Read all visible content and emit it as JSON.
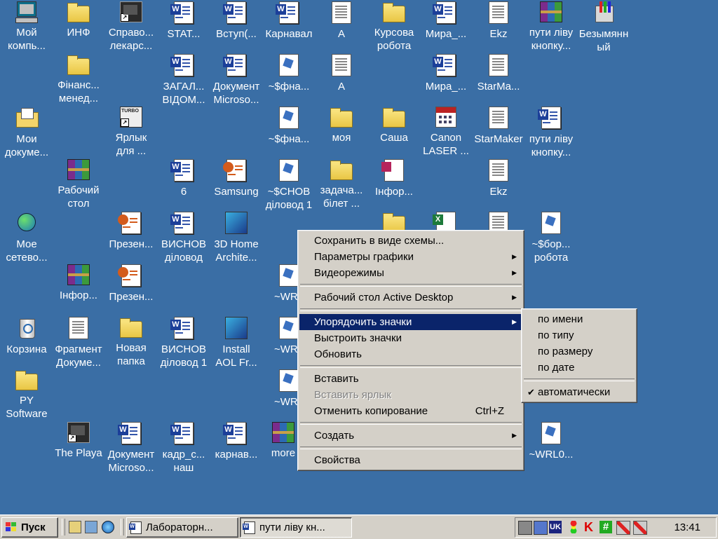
{
  "desktop": {
    "icons": [
      {
        "id": "my-computer",
        "label": "Мой\nкомпь...",
        "type": "computer"
      },
      {
        "id": "inf",
        "label": "ИНФ",
        "type": "folder"
      },
      {
        "id": "spravochnik",
        "label": "Справо...\nлекарс...",
        "type": "exe"
      },
      {
        "id": "stat",
        "label": "STAT...",
        "type": "word"
      },
      {
        "id": "vstup",
        "label": "Вступ(...",
        "type": "word"
      },
      {
        "id": "karnaval",
        "label": "Карнавал",
        "type": "word"
      },
      {
        "id": "a1",
        "label": "А",
        "type": "text"
      },
      {
        "id": "kursova",
        "label": "Курсова\nробота",
        "type": "folder"
      },
      {
        "id": "mira1",
        "label": "Мира_...",
        "type": "word"
      },
      {
        "id": "ekz1",
        "label": "Ekz",
        "type": "text"
      },
      {
        "id": "puti1",
        "label": "пути ліву\nкнопку...",
        "type": "rar"
      },
      {
        "id": "bezymyannyi",
        "label": "Безымянн\nый",
        "type": "paint"
      },
      {
        "id": "finans",
        "label": "Фінанс...\nменед...",
        "type": "folder"
      },
      {
        "id": "zagal",
        "label": "ЗАГАЛ...\nВІДОМ...",
        "type": "word"
      },
      {
        "id": "document1",
        "label": "Документ\nMicroso...",
        "type": "word"
      },
      {
        "id": "fna1",
        "label": "~$фна...",
        "type": "mwd"
      },
      {
        "id": "a2",
        "label": "А",
        "type": "text"
      },
      {
        "id": "mira2",
        "label": "Мира_...",
        "type": "word"
      },
      {
        "id": "starma",
        "label": "StarMa...",
        "type": "text"
      },
      {
        "id": "my-docs",
        "label": "Мои\nдокуме...",
        "type": "mydocs"
      },
      {
        "id": "turbo",
        "label": "Ярлык\nдля ...",
        "type": "turbo"
      },
      {
        "id": "fna2",
        "label": "~$фна...",
        "type": "mwd"
      },
      {
        "id": "moya",
        "label": "моя",
        "type": "folder"
      },
      {
        "id": "sasha",
        "label": "Саша",
        "type": "folder"
      },
      {
        "id": "canon",
        "label": "Canon\nLASER ...",
        "type": "cal"
      },
      {
        "id": "starmaker",
        "label": "StarMaker",
        "type": "text"
      },
      {
        "id": "puti2",
        "label": "пути ліву\nкнопку...",
        "type": "word"
      },
      {
        "id": "rabochiy",
        "label": "Рабочий\nстол",
        "type": "rar"
      },
      {
        "id": "six",
        "label": "6",
        "type": "word"
      },
      {
        "id": "samsung",
        "label": "Samsung",
        "type": "ppt"
      },
      {
        "id": "snov",
        "label": "~$СНОВ\nділовод 1",
        "type": "mwd"
      },
      {
        "id": "zadacha",
        "label": "задача...\nбілет ...",
        "type": "folder"
      },
      {
        "id": "infor1",
        "label": "Інфор...",
        "type": "pdfish"
      },
      {
        "id": "ekz2",
        "label": "Ekz",
        "type": "text"
      },
      {
        "id": "network",
        "label": "Мое\nсетево...",
        "type": "net"
      },
      {
        "id": "prezen1",
        "label": "Презен...",
        "type": "ppt"
      },
      {
        "id": "vysnov1",
        "label": "ВИСНОВ\nділовод",
        "type": "word"
      },
      {
        "id": "home3d",
        "label": "3D Home\nArchite...",
        "type": "img"
      },
      {
        "id": "fbor",
        "label": "~$бор...\nробота",
        "type": "mwd"
      },
      {
        "id": "infor2",
        "label": "Інфор...",
        "type": "rar"
      },
      {
        "id": "prezen2",
        "label": "Презен...",
        "type": "ppt"
      },
      {
        "id": "wrl1",
        "label": "~WRL",
        "type": "mwd"
      },
      {
        "id": "recycle",
        "label": "Корзина",
        "type": "bin"
      },
      {
        "id": "fragment",
        "label": "Фрагмент\nДокуме...",
        "type": "text"
      },
      {
        "id": "newfolder",
        "label": "Новая\nпапка",
        "type": "folder"
      },
      {
        "id": "vysnov2",
        "label": "ВИСНОВ\nділовод 1",
        "type": "word"
      },
      {
        "id": "aol",
        "label": "Install\nAOL Fr...",
        "type": "img"
      },
      {
        "id": "wrl2",
        "label": "~WRL",
        "type": "mwd"
      },
      {
        "id": "py",
        "label": "PY\nSoftware",
        "type": "folder"
      },
      {
        "id": "wrl3",
        "label": "~WRL",
        "type": "mwd"
      },
      {
        "id": "playa",
        "label": "The Playa",
        "type": "exe"
      },
      {
        "id": "document2",
        "label": "Документ\nMicroso...",
        "type": "word"
      },
      {
        "id": "kadr",
        "label": "кадр_с...\nнаш",
        "type": "word"
      },
      {
        "id": "karnav2",
        "label": "карнав...",
        "type": "word"
      },
      {
        "id": "more",
        "label": "more",
        "type": "rar"
      },
      {
        "id": "wrl0",
        "label": "~WRL0...",
        "type": "mwd"
      },
      {
        "id": "hidden-folder",
        "label": "",
        "type": "folder"
      },
      {
        "id": "hidden-xls",
        "label": "",
        "type": "xls"
      },
      {
        "id": "hidden-text",
        "label": "",
        "type": "text"
      }
    ]
  },
  "context_menu": {
    "items": [
      {
        "label": "Сохранить в виде схемы..."
      },
      {
        "label": "Параметры графики",
        "submenu": true
      },
      {
        "label": "Видеорежимы",
        "submenu": true
      },
      {
        "label": "Рабочий стол Active Desktop",
        "submenu": true
      },
      {
        "label": "Упорядочить значки",
        "submenu": true,
        "selected": true
      },
      {
        "label": "Выстроить значки"
      },
      {
        "label": "Обновить"
      },
      {
        "label": "Вставить"
      },
      {
        "label": "Вставить ярлык",
        "disabled": true
      },
      {
        "label": "Отменить копирование",
        "shortcut": "Ctrl+Z"
      },
      {
        "label": "Создать",
        "submenu": true
      },
      {
        "label": "Свойства"
      }
    ]
  },
  "submenu": {
    "items": [
      {
        "label": "по имени"
      },
      {
        "label": "по типу"
      },
      {
        "label": "по размеру"
      },
      {
        "label": "по дате"
      },
      {
        "label": "автоматически",
        "checked": true
      }
    ]
  },
  "taskbar": {
    "start_label": "Пуск",
    "tasks": [
      {
        "label": "Лабораторн..."
      },
      {
        "label": "пути ліву кн..."
      }
    ],
    "tray": {
      "lang": "UK",
      "clock": "13:41"
    }
  },
  "colors": {
    "desktop": "#3a6ea5",
    "menu_bg": "#d4d0c8",
    "selection": "#0a246a"
  }
}
